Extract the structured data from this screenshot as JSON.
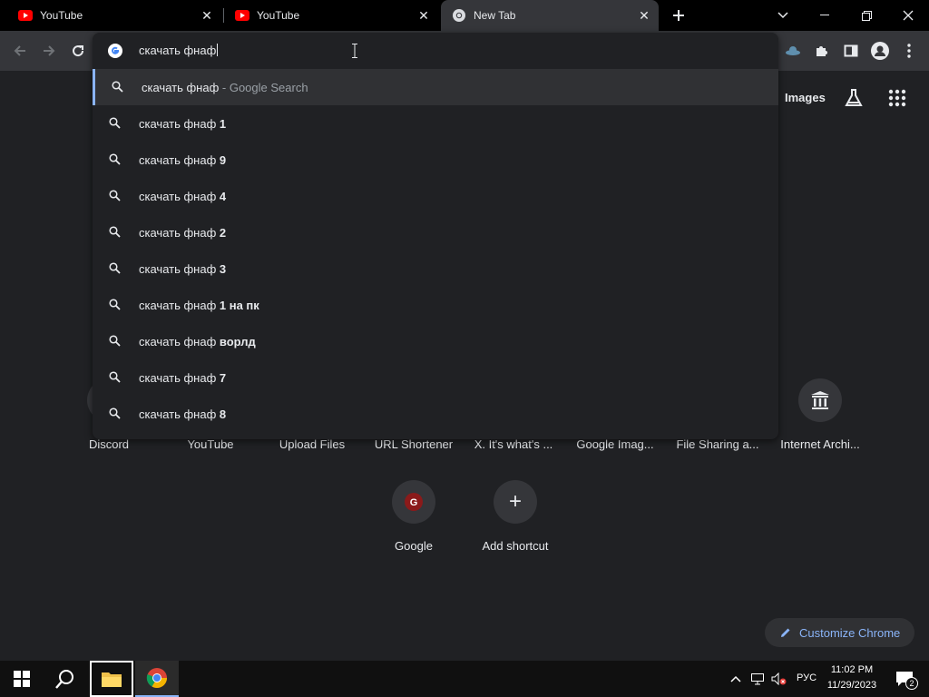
{
  "tabs": [
    {
      "title": "YouTube",
      "favicon": "youtube-icon",
      "active": false
    },
    {
      "title": "YouTube",
      "favicon": "youtube-icon",
      "active": false
    },
    {
      "title": "New Tab",
      "favicon": "chrome-icon",
      "active": true
    }
  ],
  "omnibox": {
    "input_value": "скачать фнаф",
    "suggestions": [
      {
        "prefix": "скачать фнаф",
        "bold": "",
        "hint": " - Google Search",
        "selected": true
      },
      {
        "prefix": "скачать фнаф ",
        "bold": "1",
        "hint": "",
        "selected": false
      },
      {
        "prefix": "скачать фнаф ",
        "bold": "9",
        "hint": "",
        "selected": false
      },
      {
        "prefix": "скачать фнаф ",
        "bold": "4",
        "hint": "",
        "selected": false
      },
      {
        "prefix": "скачать фнаф ",
        "bold": "2",
        "hint": "",
        "selected": false
      },
      {
        "prefix": "скачать фнаф ",
        "bold": "3",
        "hint": "",
        "selected": false
      },
      {
        "prefix": "скачать фнаф ",
        "bold": "1 на пк",
        "hint": "",
        "selected": false
      },
      {
        "prefix": "скачать фнаф ",
        "bold": "ворлд",
        "hint": "",
        "selected": false
      },
      {
        "prefix": "скачать фнаф ",
        "bold": "7",
        "hint": "",
        "selected": false
      },
      {
        "prefix": "скачать фнаф ",
        "bold": "8",
        "hint": "",
        "selected": false
      }
    ]
  },
  "header": {
    "images_link": "Images"
  },
  "shortcuts_row1": [
    "Discord",
    "YouTube",
    "Upload Files",
    "URL Shortener",
    "X. It's what's ...",
    "Google Imag...",
    "File Sharing a...",
    "Internet Archi..."
  ],
  "shortcuts_row2": [
    {
      "label": "Google",
      "icon_letter": "G"
    },
    {
      "label": "Add shortcut",
      "icon_letter": "+"
    }
  ],
  "customize": {
    "label": "Customize Chrome"
  },
  "taskbar": {
    "language": "РУС",
    "time": "11:02 PM",
    "date": "11/29/2023",
    "notification_count": "2"
  },
  "colors": {
    "accent": "#8ab4f8",
    "youtube_red": "#ff0000",
    "background": "#202124"
  }
}
